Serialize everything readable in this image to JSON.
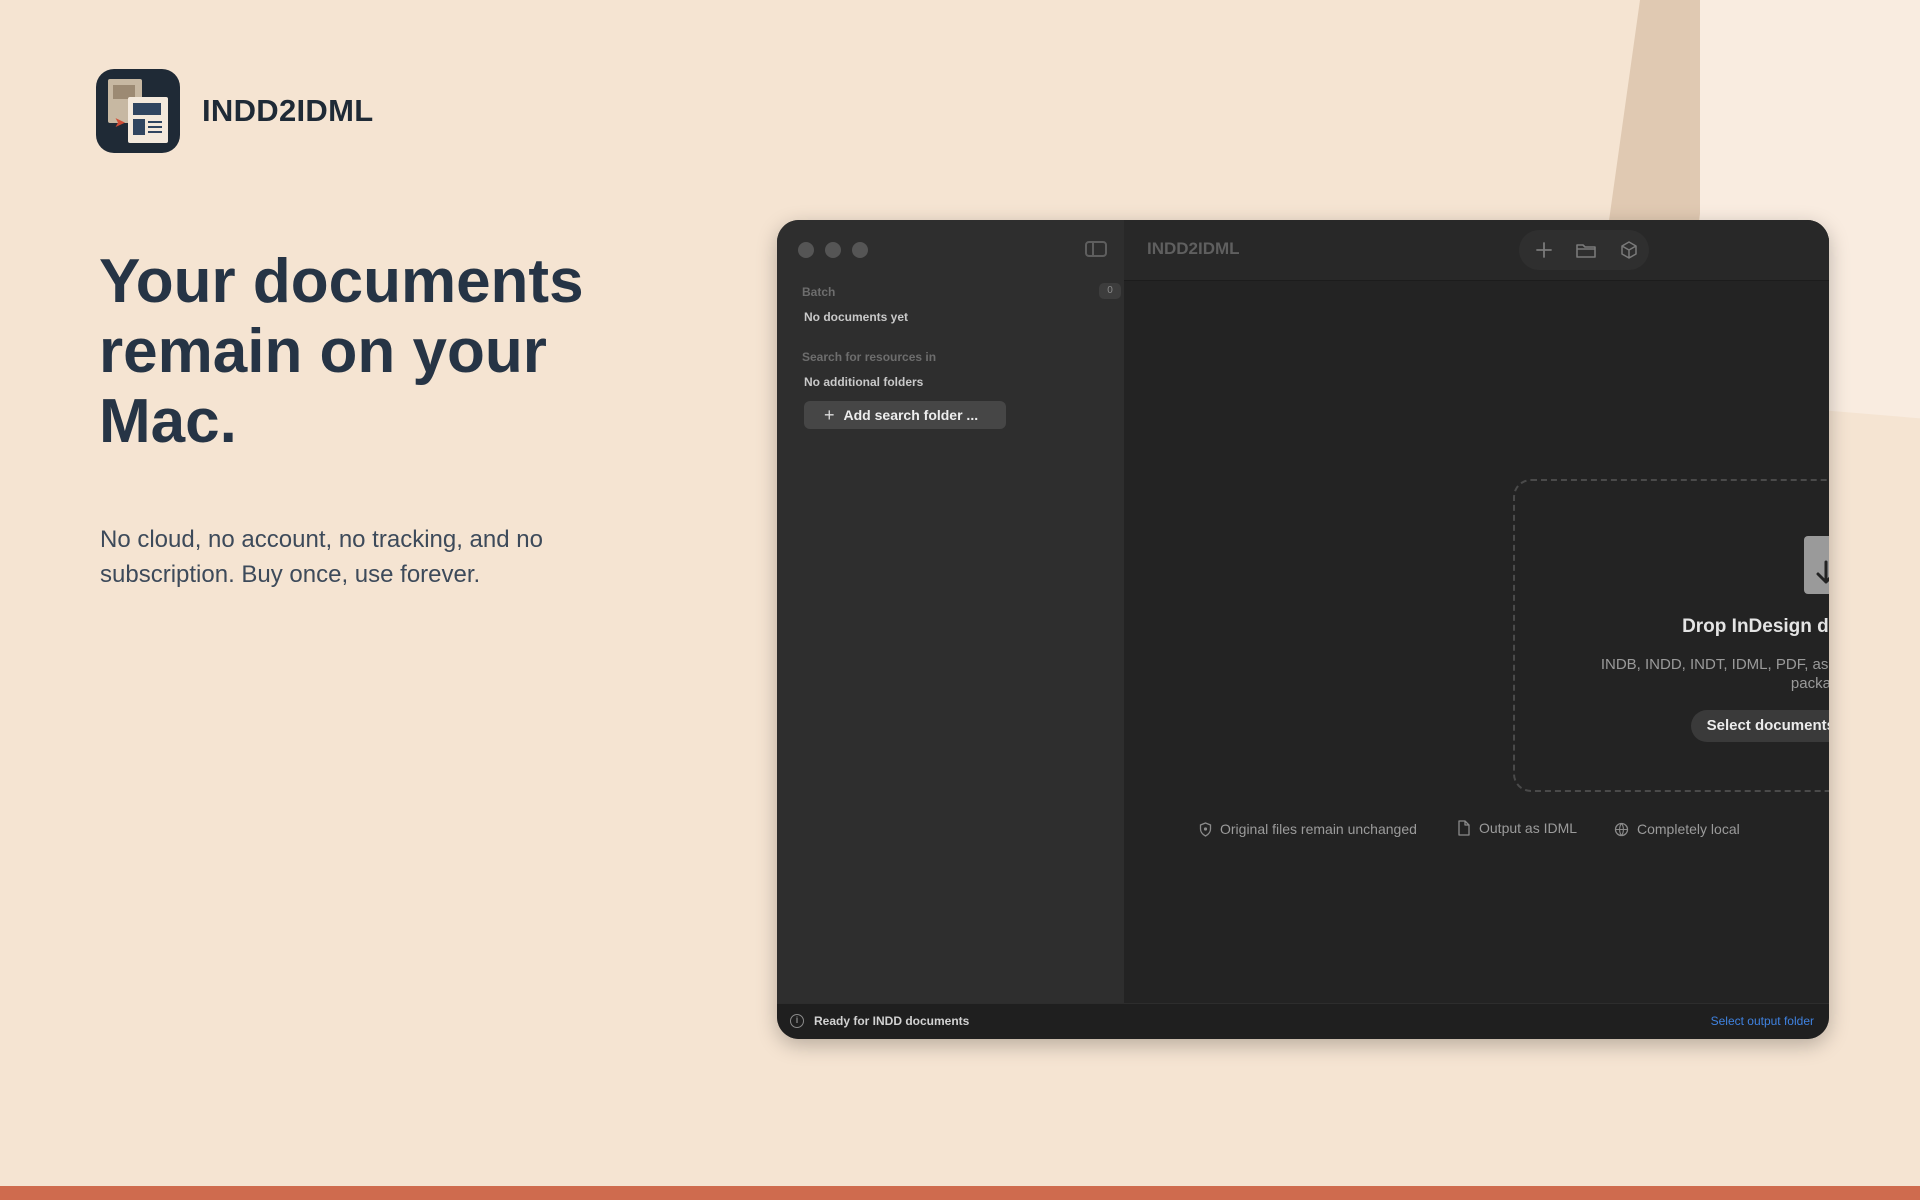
{
  "app": {
    "name": "INDD2IDML"
  },
  "hero": {
    "headline": "Your documents remain on your Mac.",
    "subtext": "No cloud, no account, no tracking, and no subscription. Buy once, use forever."
  },
  "window": {
    "title": "INDD2IDML",
    "toolbar": {
      "icons": [
        "plus-icon",
        "folder-icon",
        "package-icon",
        "convert-icon",
        "help-icon",
        "info-icon"
      ]
    },
    "sidebar": {
      "batch_label": "Batch",
      "batch_count": "0",
      "batch_empty": "No documents yet",
      "search_label": "Search for resources in",
      "search_empty": "No additional folders",
      "add_folder_label": "Add search folder ..."
    },
    "dropzone": {
      "title": "Drop InDesign documents here",
      "subtitle": "INDB, INDD, INDT, IDML, PDF, as well as package folders and ZIP packages",
      "select_label": "Select documents or packages ..."
    },
    "features": [
      {
        "icon": "shield-icon",
        "label": "Original files remain unchanged"
      },
      {
        "icon": "document-icon",
        "label": "Output as IDML"
      },
      {
        "icon": "globe-icon",
        "label": "Completely local"
      }
    ],
    "statusbar": {
      "status": "Ready for INDD documents",
      "output_link": "Select output folder"
    }
  },
  "colors": {
    "background": "#f5e4d2",
    "accent_bar": "#cf6b4e",
    "heading": "#263445",
    "link": "#3f82e0"
  }
}
